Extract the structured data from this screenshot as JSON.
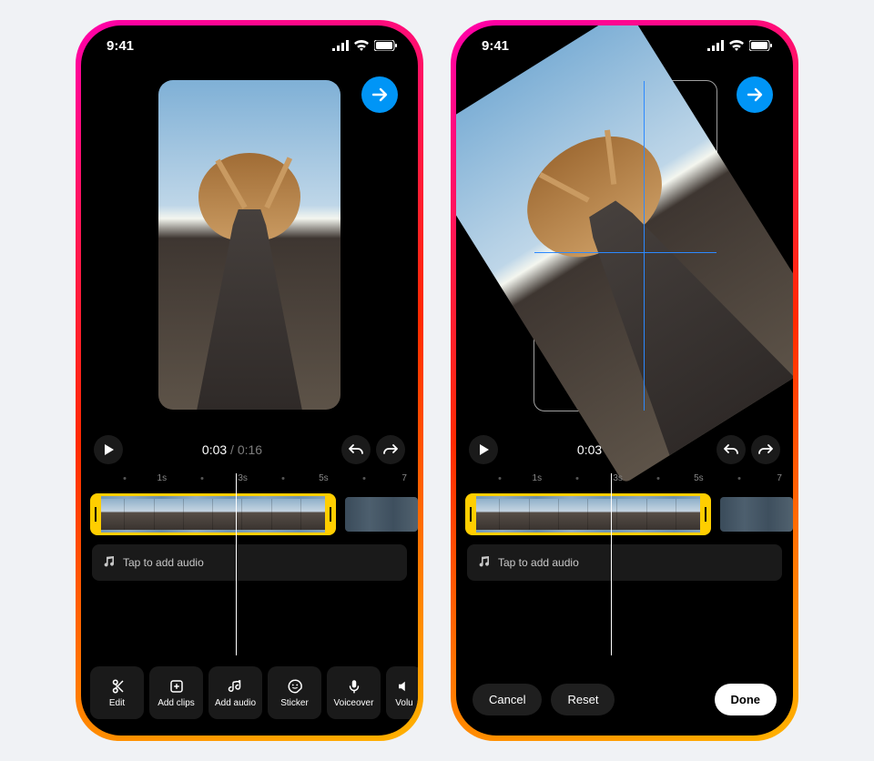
{
  "status": {
    "time": "9:41"
  },
  "next_btn_aria": "Next",
  "transport": {
    "current": "0:03",
    "sep": " / ",
    "total": "0:16"
  },
  "ruler": {
    "marks": [
      "1s",
      "3s",
      "5s",
      "7"
    ]
  },
  "audio": {
    "placeholder": "Tap to add audio"
  },
  "toolbar": {
    "items": [
      {
        "icon": "scissors",
        "label": "Edit"
      },
      {
        "icon": "clip-add",
        "label": "Add clips"
      },
      {
        "icon": "music-add",
        "label": "Add audio"
      },
      {
        "icon": "sticker",
        "label": "Sticker"
      },
      {
        "icon": "mic",
        "label": "Voiceover"
      },
      {
        "icon": "volume",
        "label": "Volu"
      }
    ]
  },
  "crop": {
    "cancel": "Cancel",
    "reset": "Reset",
    "done": "Done"
  }
}
